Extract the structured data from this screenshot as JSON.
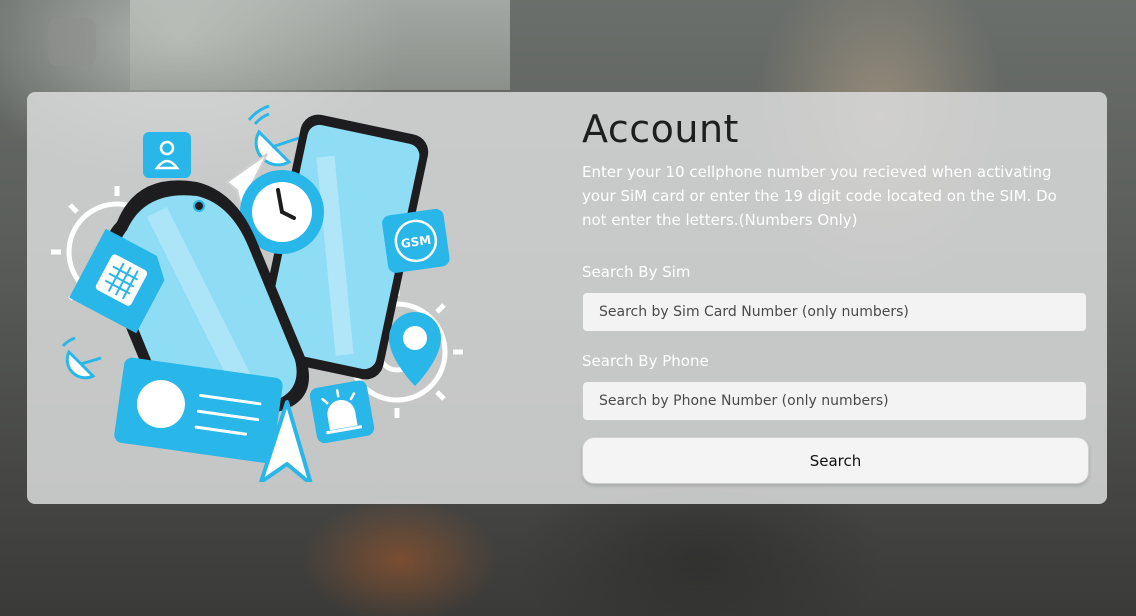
{
  "account": {
    "title": "Account",
    "description": "Enter your 10 cellphone number you recieved when activating your SiM card or enter the 19 digit code located on the SIM. Do not enter the letters.(Numbers Only)",
    "sim_label": "Search By Sim",
    "sim_placeholder": "Search by Sim Card Number (only numbers)",
    "sim_value": "",
    "phone_label": "Search By Phone",
    "phone_placeholder": "Search by Phone Number (only numbers)",
    "phone_value": "",
    "search_button": "Search"
  },
  "illustration": {
    "gsm_badge": "GSM",
    "colors": {
      "accent": "#29b6e8",
      "accent_light": "#8fdcf5",
      "outline": "#1d1d1f",
      "gear": "#ffffff"
    }
  }
}
